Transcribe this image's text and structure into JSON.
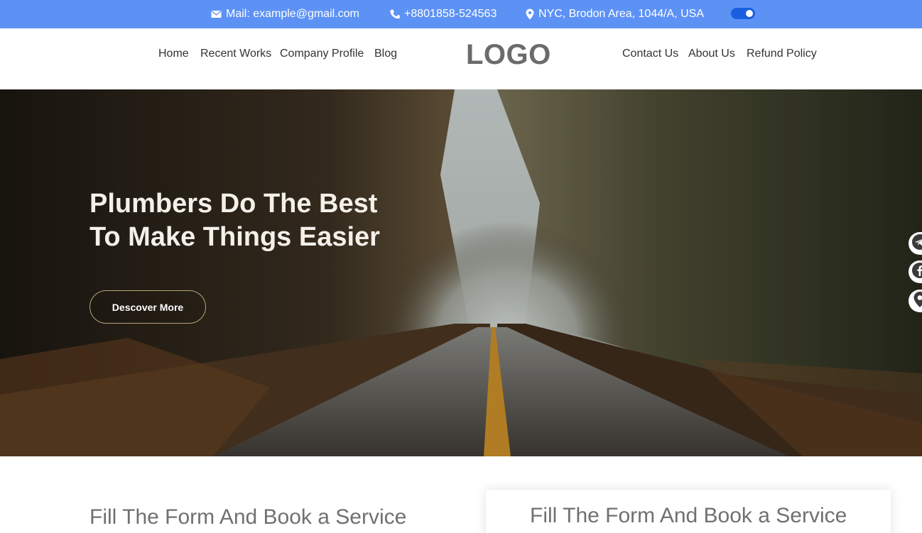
{
  "topbar": {
    "mail": "Mail: example@gmail.com",
    "phone": "+8801858-524563",
    "location": "NYC, Brodon Area, 1044/A, USA",
    "bg_color": "#5d92f5"
  },
  "nav": {
    "left": [
      "Home",
      "Recent Works",
      "Company Profile",
      "Blog"
    ],
    "logo": "LOGO",
    "right": [
      "Contact Us",
      "About Us",
      "Refund Policy"
    ]
  },
  "hero": {
    "title": "Plumbers Do The Best To Make Things Easier",
    "button": "Descover More"
  },
  "social": [
    "telegram-icon",
    "facebook-icon",
    "location-icon"
  ],
  "booking": {
    "heading": "Fill The Form And Book a Service",
    "card_heading": "Fill The Form And Book a Service"
  }
}
